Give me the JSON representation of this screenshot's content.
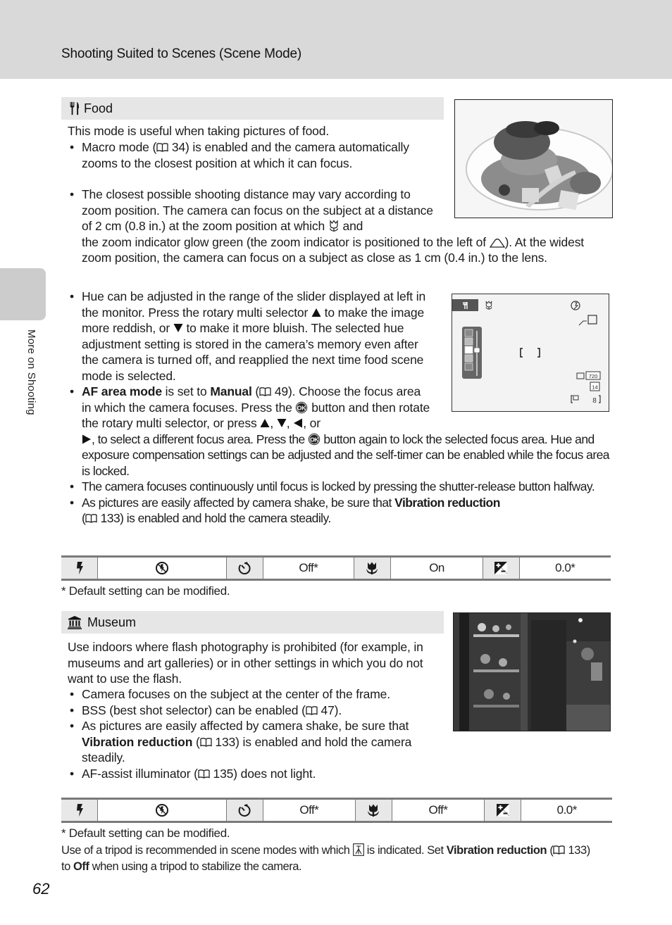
{
  "header": {
    "title": "Shooting Suited to Scenes (Scene Mode)"
  },
  "side_tab": {
    "label": "More on Shooting"
  },
  "food": {
    "title": "Food",
    "icon": "fork-knife-icon",
    "intro": "This mode is useful when taking pictures of food.",
    "bullets": [
      {
        "pre": "Macro mode (",
        "ref": "34",
        "post": ") is enabled and the camera automatically zooms to the closest position at which it can focus."
      },
      {
        "pre": "The closest possible shooting distance may vary according to zoom position. The camera can focus on the subject at a distance of 2 cm (0.8 in.) at the zoom position at which",
        "mid": "and the zoom indicator glow green (the zoom indicator is positioned to the left of",
        "post": "). At the widest zoom position, the camera can focus on a subject as close as 1 cm (0.4 in.) to the lens."
      },
      {
        "a": "Hue can be adjusted in the range of the slider displayed at left in the monitor. Press the rotary multi selector",
        "b": "to make the image more reddish, or",
        "c": "to make it more bluish. The selected hue adjustment setting is stored in the camera’s memory even after the camera is turned off, and reapplied the next time food scene mode is selected."
      },
      {
        "bold1": "AF area mode",
        "t1": " is set to ",
        "bold2": "Manual",
        "t2": " (",
        "ref": "49",
        "t3": "). Choose the focus area in which the camera focuses. Press the",
        "t4": "button and then rotate the rotary multi selector, or press",
        "t5": ", to select a different focus area. Press the",
        "t6": "button again to lock the selected focus area. Hue and exposure compensation settings can be adjusted and the self-timer can be enabled while the focus area is locked."
      },
      {
        "text": "The camera focuses continuously until focus is locked by pressing the shutter-release button halfway."
      },
      {
        "pre": "As pictures are easily affected by camera shake, be sure that ",
        "bold": "Vibration reduction",
        "mid": " (",
        "ref": "133",
        "post": ") is enabled and hold the camera steadily."
      }
    ],
    "settings": {
      "flash": "flash-off-icon",
      "self_timer": "Off*",
      "macro": "On",
      "exposure": "0.0*"
    },
    "footnote": "*  Default setting can be modified."
  },
  "monitor": {
    "focus_bracket": "[  ]"
  },
  "museum": {
    "title": "Museum",
    "icon": "museum-icon",
    "intro": "Use indoors where flash photography is prohibited (for example, in museums and art galleries) or in other settings in which you do not want to use the flash.",
    "bullets": [
      {
        "text": "Camera focuses on the subject at the center of the frame."
      },
      {
        "pre": "BSS (best shot selector) can be enabled (",
        "ref": "47",
        "post": ")."
      },
      {
        "pre": "As pictures are easily affected by camera shake, be sure that ",
        "bold": "Vibration reduction",
        "mid": " (",
        "ref": "133",
        "post": ") is enabled and hold the camera steadily."
      },
      {
        "pre": "AF-assist illuminator (",
        "ref": "135",
        "post": ") does not light."
      }
    ],
    "settings": {
      "flash": "flash-off-icon",
      "self_timer": "Off*",
      "macro": "Off*",
      "exposure": "0.0*"
    },
    "footnote": "*  Default setting can be modified."
  },
  "tripod_note": {
    "t1": "Use of a tripod is recommended in scene modes with which",
    "t2": " is indicated. Set ",
    "bold1": "Vibration reduction",
    "t3": " (",
    "ref": "133",
    "t4": ") to ",
    "bold2": "Off",
    "t5": " when using a tripod to stabilize the camera."
  },
  "page_number": "62"
}
